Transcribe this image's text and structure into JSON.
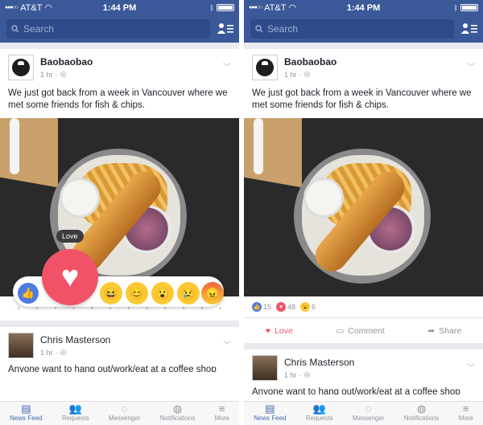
{
  "status": {
    "carrier": "AT&T",
    "time": "1:44 PM"
  },
  "search": {
    "placeholder": "Search"
  },
  "post": {
    "author": "Baobaobao",
    "time": "1 hr",
    "text": "We just got back from a week in Vancouver where we met some friends for fish & chips."
  },
  "reactions": {
    "tooltip": "Love",
    "counts": {
      "like": "15",
      "love": "48",
      "wow": "6"
    }
  },
  "actions": {
    "love": "Love",
    "comment": "Comment",
    "share": "Share"
  },
  "post2": {
    "author": "Chris Masterson",
    "time": "1 hr",
    "text": "Anyone want to hang out/work/eat at a coffee shop"
  },
  "tabs": [
    {
      "label": "News Feed",
      "icon": "news-feed-icon"
    },
    {
      "label": "Requests",
      "icon": "requests-icon"
    },
    {
      "label": "Messenger",
      "icon": "messenger-icon"
    },
    {
      "label": "Notifications",
      "icon": "globe-icon"
    },
    {
      "label": "More",
      "icon": "menu-icon"
    }
  ],
  "colors": {
    "brand": "#3b5998",
    "love": "#f25268",
    "like": "#4f7be0",
    "emoji": "#fcc934"
  }
}
